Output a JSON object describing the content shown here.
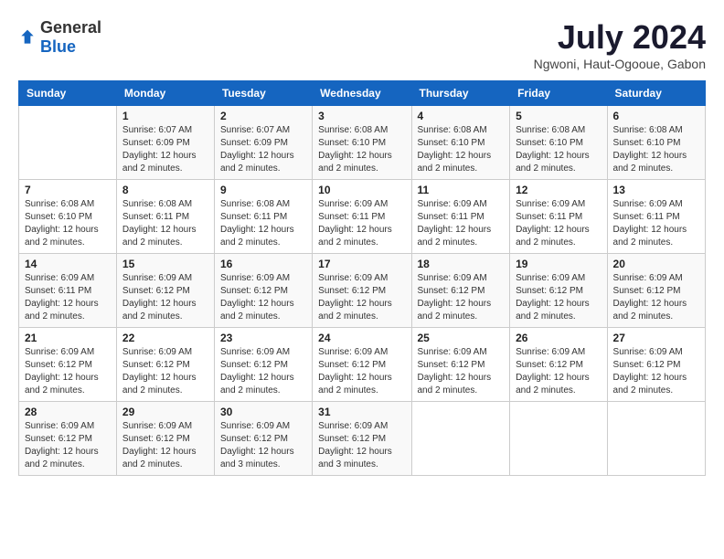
{
  "header": {
    "logo_general": "General",
    "logo_blue": "Blue",
    "month_year": "July 2024",
    "location": "Ngwoni, Haut-Ogooue, Gabon"
  },
  "columns": [
    "Sunday",
    "Monday",
    "Tuesday",
    "Wednesday",
    "Thursday",
    "Friday",
    "Saturday"
  ],
  "weeks": [
    [
      {
        "day": "",
        "info": ""
      },
      {
        "day": "1",
        "info": "Sunrise: 6:07 AM\nSunset: 6:09 PM\nDaylight: 12 hours\nand 2 minutes."
      },
      {
        "day": "2",
        "info": "Sunrise: 6:07 AM\nSunset: 6:09 PM\nDaylight: 12 hours\nand 2 minutes."
      },
      {
        "day": "3",
        "info": "Sunrise: 6:08 AM\nSunset: 6:10 PM\nDaylight: 12 hours\nand 2 minutes."
      },
      {
        "day": "4",
        "info": "Sunrise: 6:08 AM\nSunset: 6:10 PM\nDaylight: 12 hours\nand 2 minutes."
      },
      {
        "day": "5",
        "info": "Sunrise: 6:08 AM\nSunset: 6:10 PM\nDaylight: 12 hours\nand 2 minutes."
      },
      {
        "day": "6",
        "info": "Sunrise: 6:08 AM\nSunset: 6:10 PM\nDaylight: 12 hours\nand 2 minutes."
      }
    ],
    [
      {
        "day": "7",
        "info": "Sunrise: 6:08 AM\nSunset: 6:10 PM\nDaylight: 12 hours\nand 2 minutes."
      },
      {
        "day": "8",
        "info": "Sunrise: 6:08 AM\nSunset: 6:11 PM\nDaylight: 12 hours\nand 2 minutes."
      },
      {
        "day": "9",
        "info": "Sunrise: 6:08 AM\nSunset: 6:11 PM\nDaylight: 12 hours\nand 2 minutes."
      },
      {
        "day": "10",
        "info": "Sunrise: 6:09 AM\nSunset: 6:11 PM\nDaylight: 12 hours\nand 2 minutes."
      },
      {
        "day": "11",
        "info": "Sunrise: 6:09 AM\nSunset: 6:11 PM\nDaylight: 12 hours\nand 2 minutes."
      },
      {
        "day": "12",
        "info": "Sunrise: 6:09 AM\nSunset: 6:11 PM\nDaylight: 12 hours\nand 2 minutes."
      },
      {
        "day": "13",
        "info": "Sunrise: 6:09 AM\nSunset: 6:11 PM\nDaylight: 12 hours\nand 2 minutes."
      }
    ],
    [
      {
        "day": "14",
        "info": "Sunrise: 6:09 AM\nSunset: 6:11 PM\nDaylight: 12 hours\nand 2 minutes."
      },
      {
        "day": "15",
        "info": "Sunrise: 6:09 AM\nSunset: 6:12 PM\nDaylight: 12 hours\nand 2 minutes."
      },
      {
        "day": "16",
        "info": "Sunrise: 6:09 AM\nSunset: 6:12 PM\nDaylight: 12 hours\nand 2 minutes."
      },
      {
        "day": "17",
        "info": "Sunrise: 6:09 AM\nSunset: 6:12 PM\nDaylight: 12 hours\nand 2 minutes."
      },
      {
        "day": "18",
        "info": "Sunrise: 6:09 AM\nSunset: 6:12 PM\nDaylight: 12 hours\nand 2 minutes."
      },
      {
        "day": "19",
        "info": "Sunrise: 6:09 AM\nSunset: 6:12 PM\nDaylight: 12 hours\nand 2 minutes."
      },
      {
        "day": "20",
        "info": "Sunrise: 6:09 AM\nSunset: 6:12 PM\nDaylight: 12 hours\nand 2 minutes."
      }
    ],
    [
      {
        "day": "21",
        "info": "Sunrise: 6:09 AM\nSunset: 6:12 PM\nDaylight: 12 hours\nand 2 minutes."
      },
      {
        "day": "22",
        "info": "Sunrise: 6:09 AM\nSunset: 6:12 PM\nDaylight: 12 hours\nand 2 minutes."
      },
      {
        "day": "23",
        "info": "Sunrise: 6:09 AM\nSunset: 6:12 PM\nDaylight: 12 hours\nand 2 minutes."
      },
      {
        "day": "24",
        "info": "Sunrise: 6:09 AM\nSunset: 6:12 PM\nDaylight: 12 hours\nand 2 minutes."
      },
      {
        "day": "25",
        "info": "Sunrise: 6:09 AM\nSunset: 6:12 PM\nDaylight: 12 hours\nand 2 minutes."
      },
      {
        "day": "26",
        "info": "Sunrise: 6:09 AM\nSunset: 6:12 PM\nDaylight: 12 hours\nand 2 minutes."
      },
      {
        "day": "27",
        "info": "Sunrise: 6:09 AM\nSunset: 6:12 PM\nDaylight: 12 hours\nand 2 minutes."
      }
    ],
    [
      {
        "day": "28",
        "info": "Sunrise: 6:09 AM\nSunset: 6:12 PM\nDaylight: 12 hours\nand 2 minutes."
      },
      {
        "day": "29",
        "info": "Sunrise: 6:09 AM\nSunset: 6:12 PM\nDaylight: 12 hours\nand 2 minutes."
      },
      {
        "day": "30",
        "info": "Sunrise: 6:09 AM\nSunset: 6:12 PM\nDaylight: 12 hours\nand 3 minutes."
      },
      {
        "day": "31",
        "info": "Sunrise: 6:09 AM\nSunset: 6:12 PM\nDaylight: 12 hours\nand 3 minutes."
      },
      {
        "day": "",
        "info": ""
      },
      {
        "day": "",
        "info": ""
      },
      {
        "day": "",
        "info": ""
      }
    ]
  ]
}
